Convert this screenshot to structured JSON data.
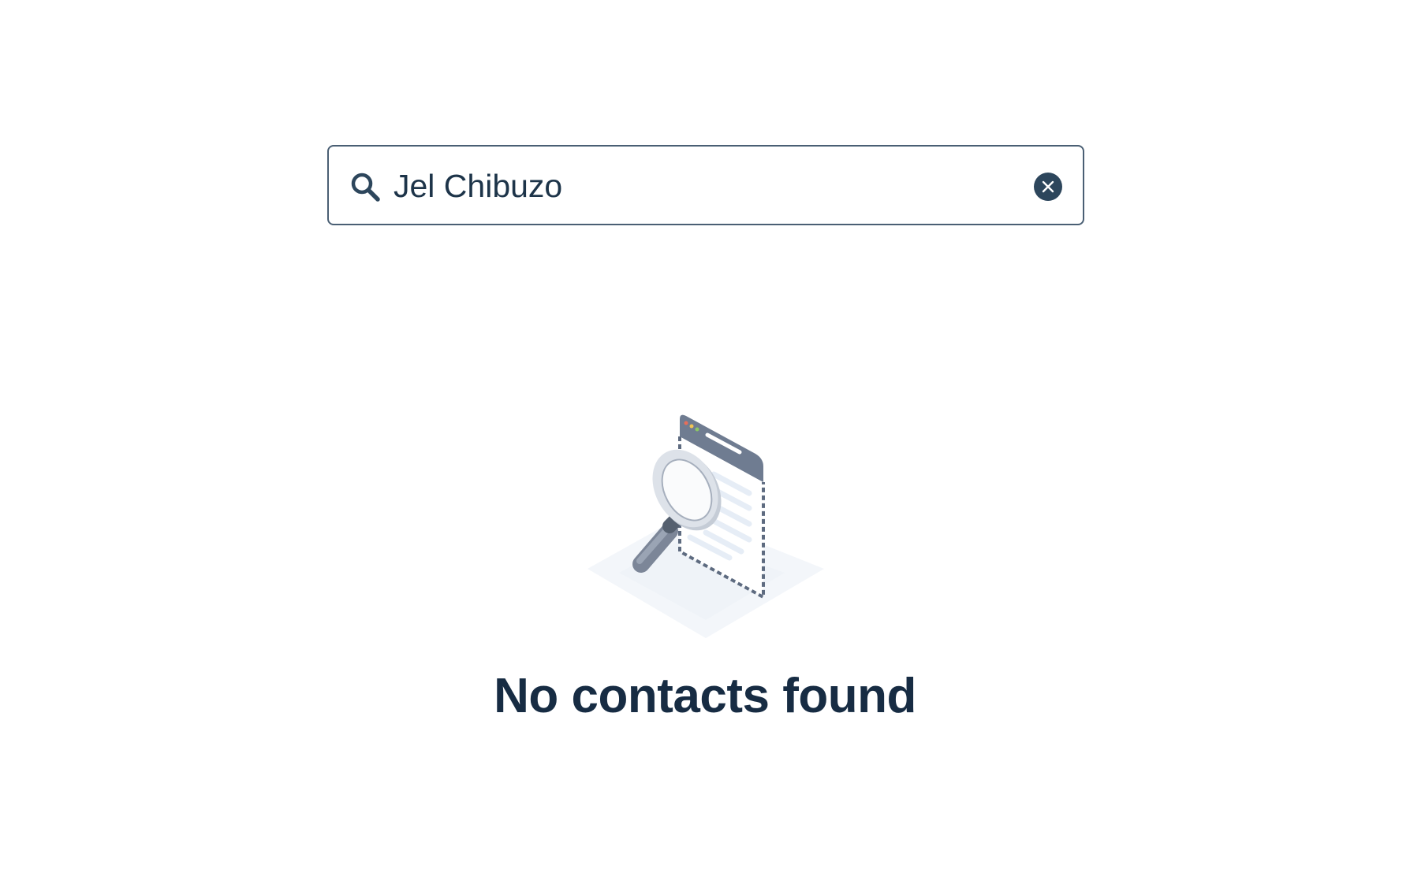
{
  "search": {
    "value": "Jel Chibuzo",
    "icon": "search-icon",
    "clear_icon": "clear-circle-icon"
  },
  "empty_state": {
    "illustration_icon": "magnifier-document-icon",
    "title": "No contacts found"
  },
  "colors": {
    "border": "#4a5f74",
    "text": "#1d3449",
    "title": "#172c43",
    "clear_button": "#2d465c"
  }
}
